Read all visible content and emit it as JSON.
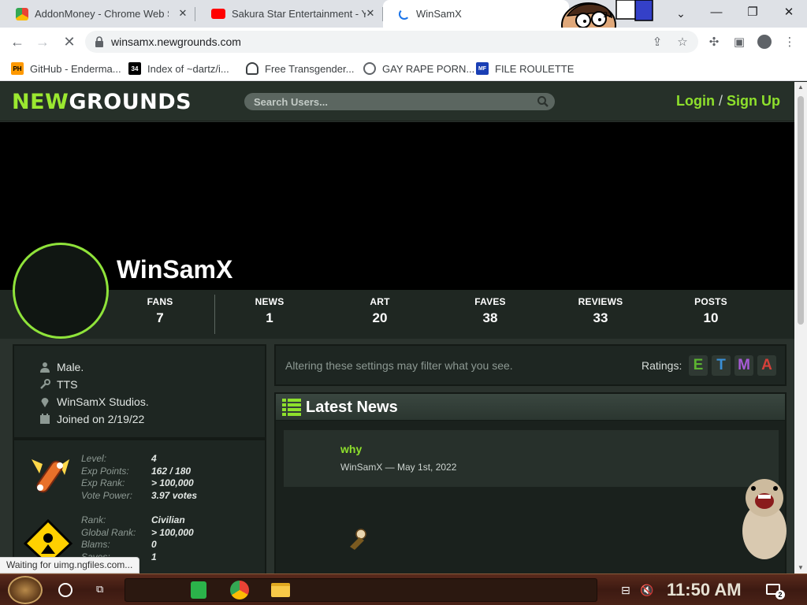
{
  "browser": {
    "tabs": [
      {
        "title": "AddonMoney - Chrome Web Sto",
        "close": "✕"
      },
      {
        "title": "Sakura Star Entertainment - Y",
        "close": "✕"
      },
      {
        "title": "WinSamX",
        "close": ""
      }
    ],
    "url": "winsamx.newgrounds.com",
    "bookmarks": [
      {
        "label": "GitHub - Enderma...",
        "icon_text": "PH"
      },
      {
        "label": "Index of ~dartz/i...",
        "icon_text": "34"
      },
      {
        "label": "Free Transgender...",
        "icon_text": ""
      },
      {
        "label": "GAY RAPE PORN...",
        "icon_text": ""
      },
      {
        "label": "FILE ROULETTE",
        "icon_text": "MF"
      }
    ],
    "status_text": "Waiting for uimg.ngfiles.com..."
  },
  "site": {
    "logo_new": "NEW",
    "logo_grounds": "GROUNDS",
    "search_placeholder": "Search Users...",
    "login": "Login",
    "slash": "/",
    "signup": "Sign Up"
  },
  "profile": {
    "username": "WinSamX",
    "stats": [
      {
        "label": "FANS",
        "value": "7"
      },
      {
        "label": "NEWS",
        "value": "1"
      },
      {
        "label": "ART",
        "value": "20"
      },
      {
        "label": "FAVES",
        "value": "38"
      },
      {
        "label": "REVIEWS",
        "value": "33"
      },
      {
        "label": "POSTS",
        "value": "10"
      }
    ],
    "info": {
      "gender": "Male.",
      "occupation": "TTS",
      "location": "WinSamX Studios.",
      "joined": "Joined on 2/19/22"
    },
    "level": {
      "labels": [
        "Level:",
        "Exp Points:",
        "Exp Rank:",
        "Vote Power:"
      ],
      "values": [
        "4",
        "162 / 180",
        "> 100,000",
        "3.97 votes"
      ]
    },
    "rank": {
      "labels": [
        "Rank:",
        "Global Rank:",
        "Blams:",
        "Saves:"
      ],
      "values": [
        "Civilian",
        "> 100,000",
        "0",
        "1"
      ]
    }
  },
  "filter": {
    "text": "Altering these settings may filter what you see.",
    "ratings_label": "Ratings:",
    "badges": [
      {
        "letter": "E",
        "color": "#5cb531"
      },
      {
        "letter": "T",
        "color": "#3a8fd6"
      },
      {
        "letter": "M",
        "color": "#a75bd6"
      },
      {
        "letter": "A",
        "color": "#d6403a"
      }
    ]
  },
  "news": {
    "heading": "Latest News",
    "item_title": "why",
    "item_meta": "WinSamX — May 1st, 2022"
  },
  "taskbar": {
    "clock": "11:50 AM",
    "notification_count": "2"
  }
}
